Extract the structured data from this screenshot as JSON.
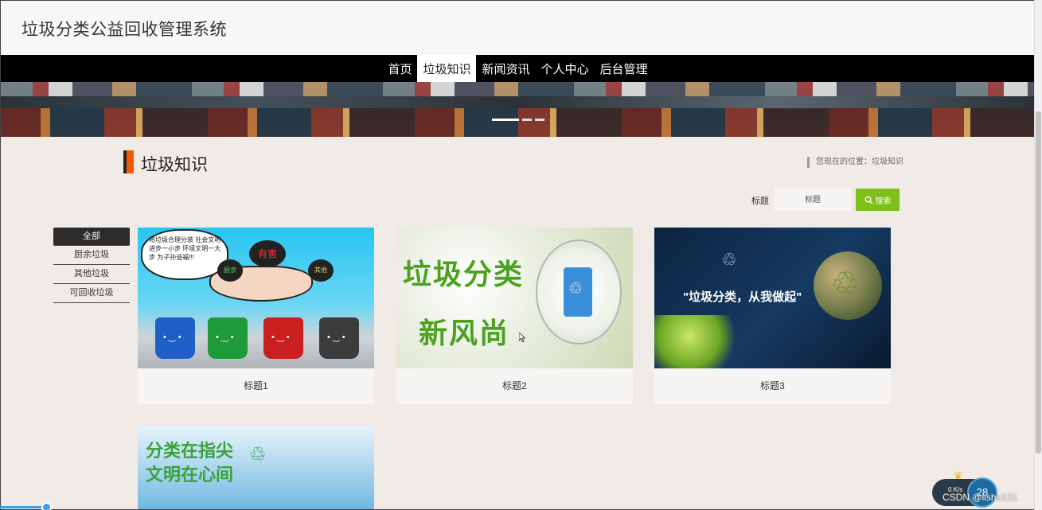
{
  "site": {
    "title": "垃圾分类公益回收管理系统"
  },
  "nav": {
    "items": [
      {
        "label": "首页",
        "active": false
      },
      {
        "label": "垃圾知识",
        "active": true
      },
      {
        "label": "新闻资讯",
        "active": false
      },
      {
        "label": "个人中心",
        "active": false
      },
      {
        "label": "后台管理",
        "active": false
      }
    ]
  },
  "section": {
    "title": "垃圾知识",
    "breadcrumb": "您现在的位置：垃圾知识"
  },
  "search": {
    "label": "标题",
    "placeholder": "标题",
    "button_label": "搜索"
  },
  "categories": [
    {
      "label": "全部",
      "active": true
    },
    {
      "label": "厨余垃圾",
      "active": false
    },
    {
      "label": "其他垃圾",
      "active": false
    },
    {
      "label": "可回收垃圾",
      "active": false
    }
  ],
  "cards": [
    {
      "caption": "标题1",
      "image": {
        "bubble_text": "将垃圾合理分装 社会文明进步一小步 环境文明一大步 为子孙造福!!!",
        "bag_main": "有害",
        "bag_left": "厨余",
        "bag_right": "其他"
      }
    },
    {
      "caption": "标题2",
      "image": {
        "line1": "垃圾分类",
        "line2": "新风尚"
      }
    },
    {
      "caption": "标题3",
      "image": {
        "slogan": "\"垃圾分类，从我做起\""
      }
    },
    {
      "caption": "",
      "image": {
        "line1": "分类在指尖",
        "line2": "文明在心间"
      }
    }
  ],
  "overlay": {
    "speed": "0 K/s",
    "widget_value": "28",
    "watermark": "CSDN @lishe131"
  },
  "colors": {
    "accent_orange": "#f25c05",
    "search_green": "#7fbf1a",
    "nav_bg": "#000000",
    "page_bg": "#f1ebe8"
  }
}
